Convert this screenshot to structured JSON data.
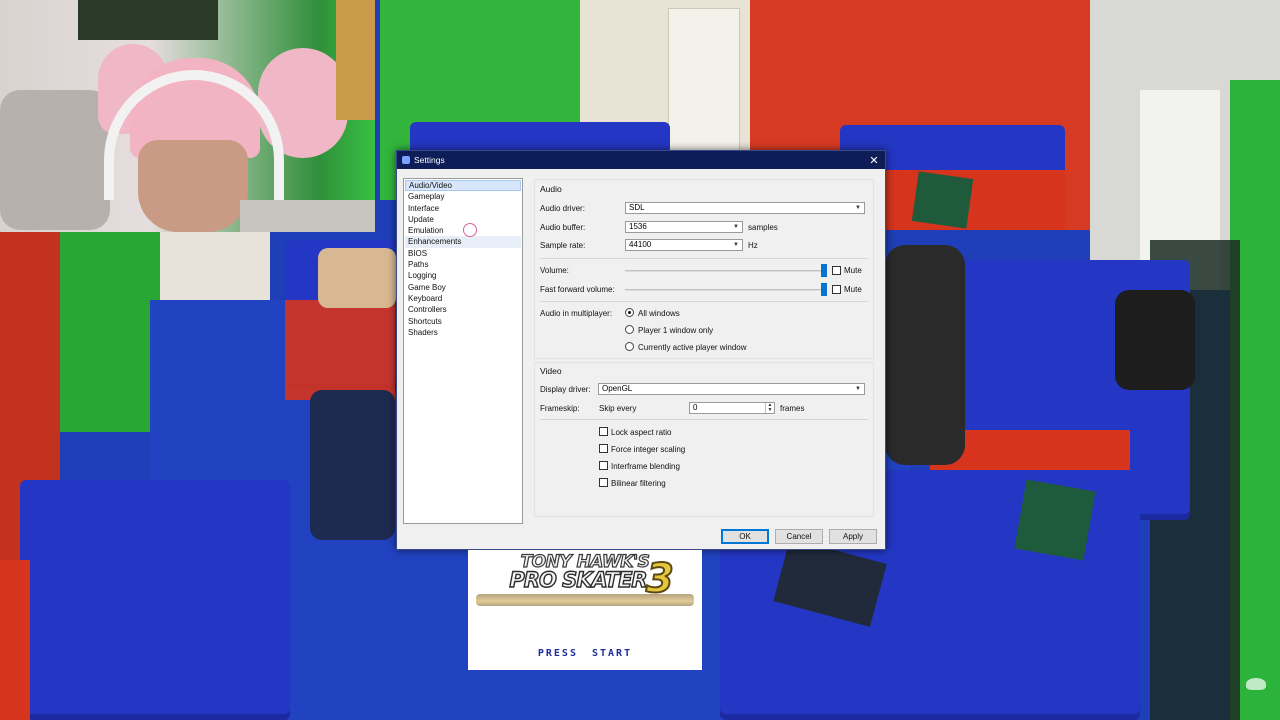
{
  "dialog": {
    "title": "Settings",
    "close_glyph": "✕",
    "nav_items": [
      {
        "label": "Audio/Video",
        "selected": true
      },
      {
        "label": "Gameplay"
      },
      {
        "label": "Interface"
      },
      {
        "label": "Update"
      },
      {
        "label": "Emulation"
      },
      {
        "label": "Enhancements"
      },
      {
        "label": "BIOS"
      },
      {
        "label": "Paths"
      },
      {
        "label": "Logging"
      },
      {
        "label": "Game Boy"
      },
      {
        "label": "Keyboard"
      },
      {
        "label": "Controllers"
      },
      {
        "label": "Shortcuts"
      },
      {
        "label": "Shaders"
      }
    ],
    "audio": {
      "group_label": "Audio",
      "driver_label": "Audio driver:",
      "driver_value": "SDL",
      "buffer_label": "Audio buffer:",
      "buffer_value": "1536",
      "buffer_unit": "samples",
      "rate_label": "Sample rate:",
      "rate_value": "44100",
      "rate_unit": "Hz",
      "volume_label": "Volume:",
      "volume_level": 1.0,
      "ff_volume_label": "Fast forward volume:",
      "ff_volume_level": 1.0,
      "mute_label": "Mute",
      "multiplayer_label": "Audio in multiplayer:",
      "multiplayer_options": [
        {
          "label": "All windows",
          "selected": true
        },
        {
          "label": "Player 1 window only"
        },
        {
          "label": "Currently active player window"
        }
      ]
    },
    "video": {
      "group_label": "Video",
      "driver_label": "Display driver:",
      "driver_value": "OpenGL",
      "frameskip_label": "Frameskip:",
      "skip_every_label": "Skip every",
      "frameskip_value": "0",
      "frames_unit": "frames",
      "checkboxes": [
        {
          "label": "Lock aspect ratio",
          "checked": false
        },
        {
          "label": "Force integer scaling",
          "checked": false
        },
        {
          "label": "Interframe blending",
          "checked": false
        },
        {
          "label": "Bilinear filtering",
          "checked": false
        }
      ]
    },
    "buttons": {
      "ok": "OK",
      "cancel": "Cancel",
      "apply": "Apply"
    }
  },
  "game": {
    "logo_top": "TONY HAWK'S",
    "logo_bottom": "PRO SKATER",
    "logo_number": "3",
    "press_start": "PRESS START"
  },
  "colors": {
    "wall_green": "#2fb23a",
    "wall_red": "#d7341d",
    "carpet_blue": "#1f3fb8",
    "titlebar": "#0c1d57",
    "accent": "#0078d7"
  }
}
